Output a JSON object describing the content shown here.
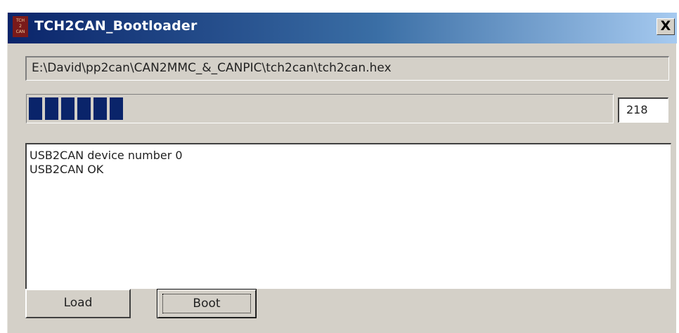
{
  "window": {
    "title": "TCH2CAN_Bootloader",
    "app_icon": "tch2can-app-icon",
    "close_label": "X"
  },
  "file": {
    "path": "E:\\David\\pp2can\\CAN2MMC_&_CANPIC\\tch2can\\tch2can.hex"
  },
  "progress": {
    "blocks_shown": 6,
    "fraction": 0.18,
    "count": "218",
    "fill_color": "#0a246a"
  },
  "log": {
    "lines": [
      "USB2CAN device number 0",
      "USB2CAN OK"
    ]
  },
  "buttons": {
    "load_label": "Load",
    "boot_label": "Boot"
  },
  "colors": {
    "titlebar_start": "#0a246a",
    "titlebar_end": "#a6caf0",
    "window_face": "#d4d0c8"
  }
}
